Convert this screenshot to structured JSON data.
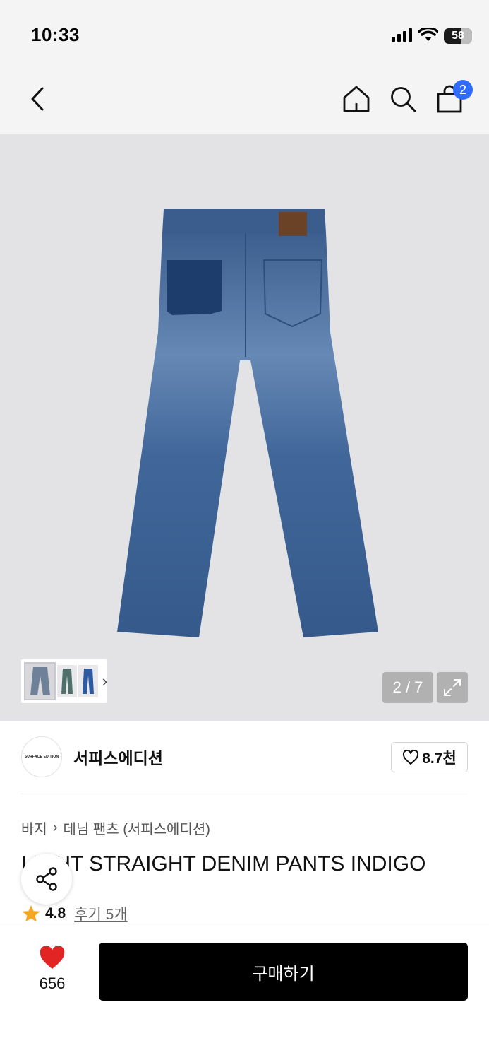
{
  "status_bar": {
    "time": "10:33",
    "battery": "58"
  },
  "nav": {
    "cart_count": "2"
  },
  "gallery": {
    "page_indicator": "2 / 7"
  },
  "brand": {
    "logo_text": "SURFACE EDITION",
    "name": "서피스에디션",
    "follow_count": "8.7천"
  },
  "breadcrumb": {
    "category": "바지",
    "separator": "›",
    "subcategory": "데님 팬츠 (서피스에디션)"
  },
  "product": {
    "title": "LIGHT STRAIGHT DENIM PANTS INDIGO",
    "rating": "4.8",
    "reviews": "후기 5개"
  },
  "bottom": {
    "like_count": "656",
    "buy_label": "구매하기"
  },
  "colors": {
    "accent_blue": "#2f6bff",
    "heart_red": "#e32424",
    "star_orange": "#f5a623",
    "buy_black": "#000000"
  },
  "icons": [
    "back-arrow-icon",
    "home-icon",
    "search-icon",
    "shopping-bag-icon",
    "expand-icon",
    "share-icon",
    "star-icon",
    "heart-icon",
    "chevron-right-icon"
  ]
}
